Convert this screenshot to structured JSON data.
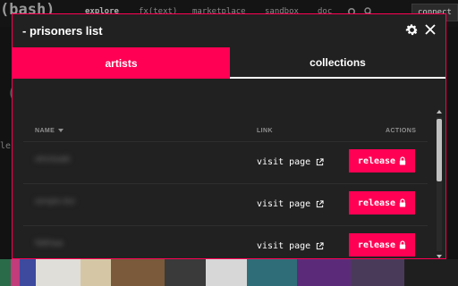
{
  "background": {
    "logo": "(bash)",
    "nav": [
      "explore",
      "fx(text)",
      "marketplace",
      "sandbox",
      "doc"
    ],
    "connect_label": "connect",
    "side_left_text": "le"
  },
  "modal": {
    "title": "- prisoners list",
    "tabs": [
      {
        "label": "artists",
        "active": true
      },
      {
        "label": "collections",
        "active": false
      }
    ],
    "columns": {
      "name": "NAME",
      "link": "LINK",
      "actions": "ACTIONS"
    },
    "rows": [
      {
        "name": "ohmisaki",
        "link": "visit page",
        "action": "release"
      },
      {
        "name": "zenpix.tez",
        "link": "visit page",
        "action": "release"
      },
      {
        "name": "Nikhaa",
        "link": "visit page",
        "action": "release"
      }
    ]
  },
  "colors": {
    "accent": "#ff0054",
    "modal_bg": "#212121",
    "page_bg": "#1a1a1a"
  },
  "icons": [
    "gear-icon",
    "close-icon",
    "sort-desc-icon",
    "external-link-icon",
    "lock-icon"
  ]
}
